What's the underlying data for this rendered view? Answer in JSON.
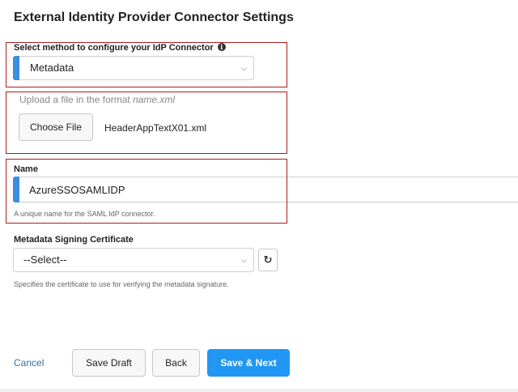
{
  "page": {
    "title": "External Identity Provider Connector Settings"
  },
  "method": {
    "label": "Select method to configure your IdP Connector",
    "selected": "Metadata"
  },
  "upload": {
    "hint_prefix": "Upload a file in the format ",
    "hint_format": "name.xml",
    "button_label": "Choose File",
    "file_name": "HeaderAppTextX01.xml"
  },
  "name_field": {
    "label": "Name",
    "value": "AzureSSOSAMLIDP",
    "help": "A unique name for the SAML IdP connector."
  },
  "certificate": {
    "label": "Metadata Signing Certificate",
    "selected": "--Select--",
    "help": "Specifies the certificate to use for verifying the metadata signature."
  },
  "footer": {
    "cancel_label": "Cancel",
    "save_draft_label": "Save Draft",
    "back_label": "Back",
    "save_next_label": "Save & Next"
  },
  "icons": {
    "info": "info-icon",
    "chevron": "chevron-down-icon",
    "refresh": "refresh-icon"
  },
  "colors": {
    "accent": "#3b8fe0",
    "primary_button": "#2196f3",
    "highlight_box": "#b11c1c",
    "link": "#2f6eae"
  }
}
